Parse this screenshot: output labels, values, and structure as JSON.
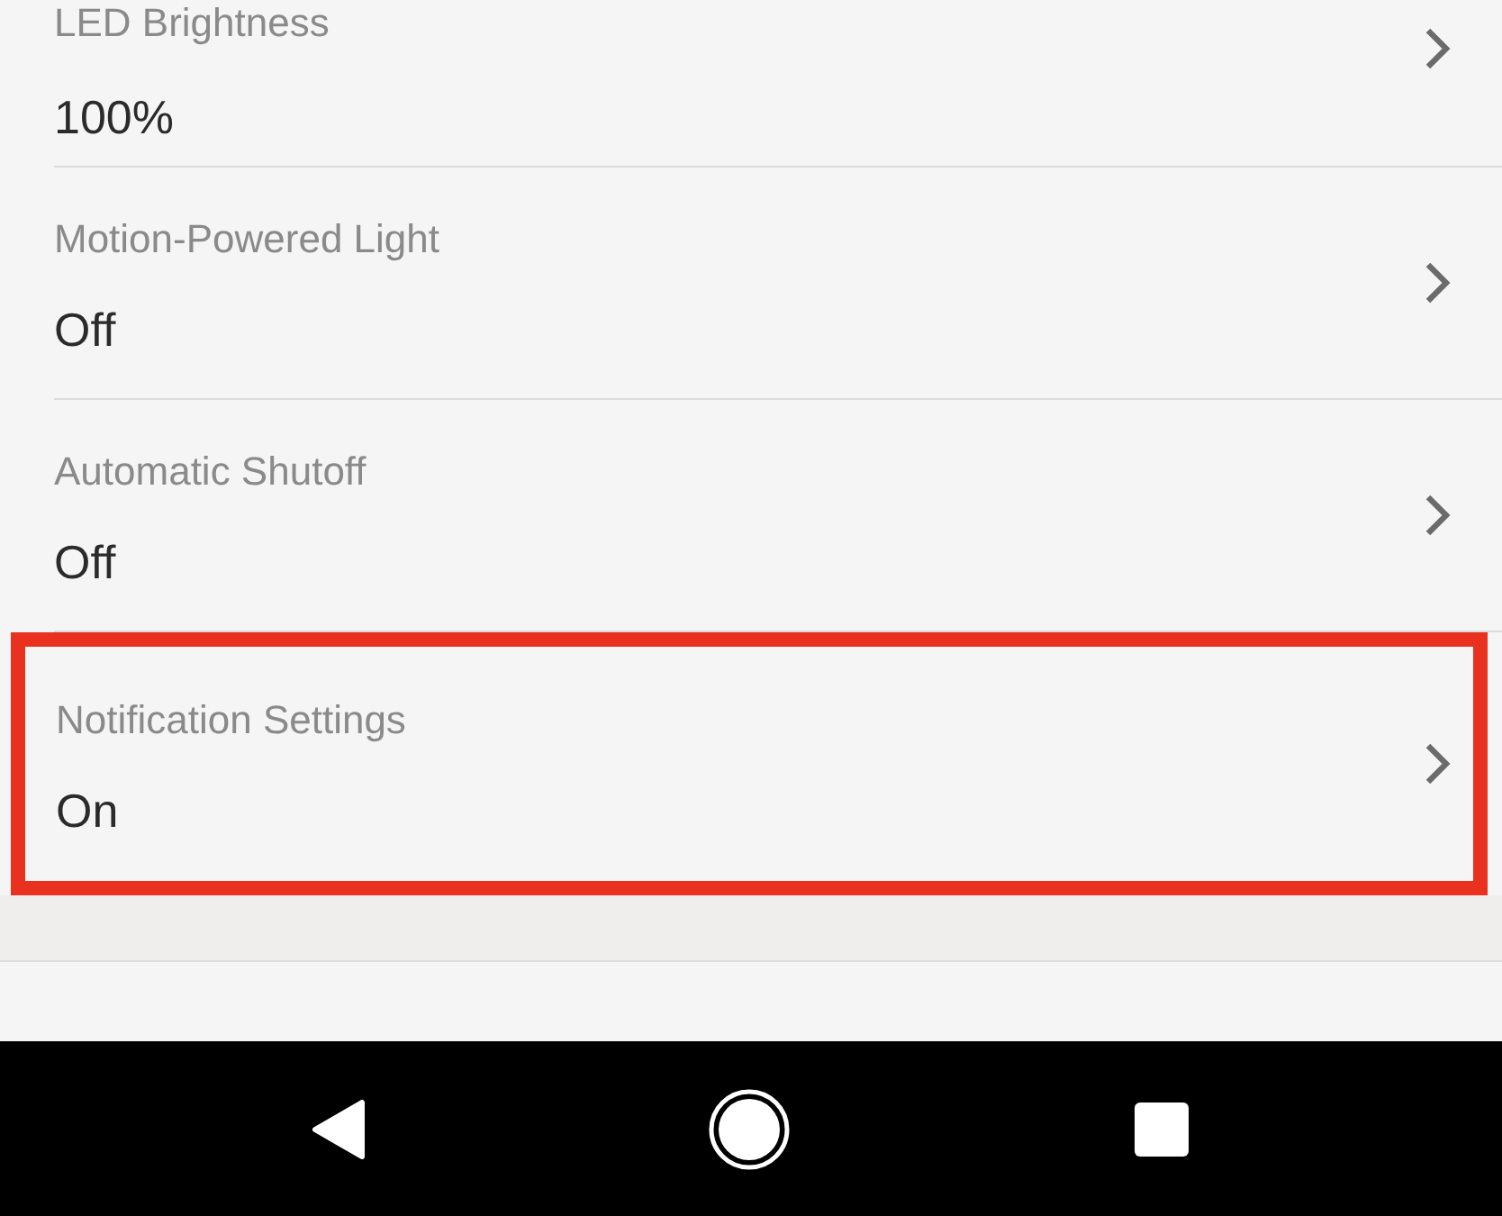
{
  "settings": [
    {
      "label": "LED Brightness",
      "value": "100%",
      "highlighted": false
    },
    {
      "label": "Motion-Powered Light",
      "value": "Off",
      "highlighted": false
    },
    {
      "label": "Automatic Shutoff",
      "value": "Off",
      "highlighted": false
    },
    {
      "label": "Notification Settings",
      "value": "On",
      "highlighted": true
    }
  ],
  "nav_bar": {
    "buttons": [
      {
        "kind": "back"
      },
      {
        "kind": "home"
      },
      {
        "kind": "recents"
      }
    ]
  }
}
